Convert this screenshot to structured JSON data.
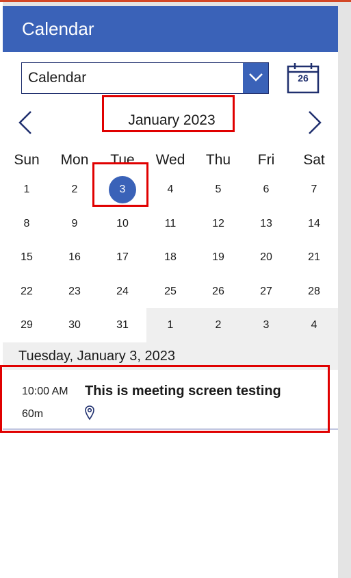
{
  "header": {
    "title": "Calendar"
  },
  "picker": {
    "selected": "Calendar"
  },
  "date_icon": {
    "day": "26",
    "icon": "calendar-icon"
  },
  "nav": {
    "month_label": "January 2023",
    "prev_icon": "chevron-left-icon",
    "next_icon": "chevron-right-icon"
  },
  "weekdays": [
    "Sun",
    "Mon",
    "Tue",
    "Wed",
    "Thu",
    "Fri",
    "Sat"
  ],
  "weeks": [
    [
      {
        "d": "1"
      },
      {
        "d": "2"
      },
      {
        "d": "3",
        "selected": true
      },
      {
        "d": "4"
      },
      {
        "d": "5"
      },
      {
        "d": "6"
      },
      {
        "d": "7"
      }
    ],
    [
      {
        "d": "8"
      },
      {
        "d": "9"
      },
      {
        "d": "10"
      },
      {
        "d": "11"
      },
      {
        "d": "12"
      },
      {
        "d": "13"
      },
      {
        "d": "14"
      }
    ],
    [
      {
        "d": "15"
      },
      {
        "d": "16"
      },
      {
        "d": "17"
      },
      {
        "d": "18"
      },
      {
        "d": "19"
      },
      {
        "d": "20"
      },
      {
        "d": "21"
      }
    ],
    [
      {
        "d": "22"
      },
      {
        "d": "23"
      },
      {
        "d": "24"
      },
      {
        "d": "25"
      },
      {
        "d": "26"
      },
      {
        "d": "27"
      },
      {
        "d": "28"
      }
    ],
    [
      {
        "d": "29"
      },
      {
        "d": "30"
      },
      {
        "d": "31"
      },
      {
        "d": "1",
        "other": true
      },
      {
        "d": "2",
        "other": true
      },
      {
        "d": "3",
        "other": true
      },
      {
        "d": "4",
        "other": true
      }
    ]
  ],
  "selected_date_label": "Tuesday, January 3, 2023",
  "events": [
    {
      "time": "10:00 AM",
      "title": "This is meeting screen testing",
      "duration": "60m",
      "location_icon": "location-pin-icon"
    }
  ],
  "colors": {
    "accent": "#3a62b8",
    "navy": "#1f2f6e",
    "highlight": "#e00000",
    "muted_bg": "#efefef"
  }
}
